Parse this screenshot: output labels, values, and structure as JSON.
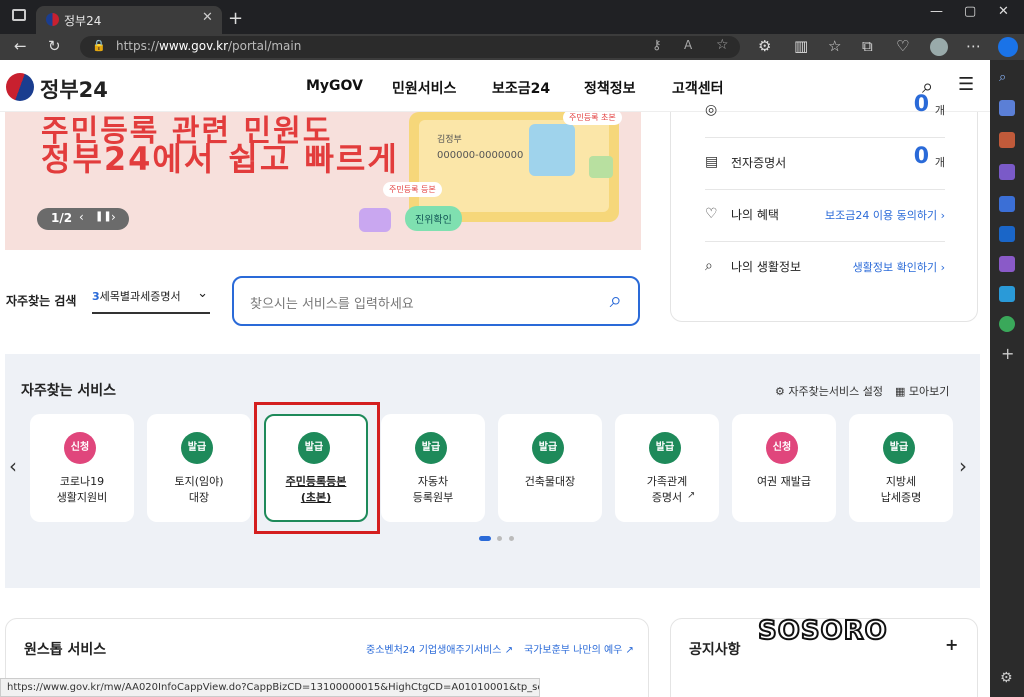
{
  "browser": {
    "tab_title": "정부24",
    "url_prefix": "https://",
    "url_host": "www.gov.kr",
    "url_path": "/portal/main",
    "status_url": "https://www.gov.kr/mw/AA020InfoCappView.do?CappBizCD=13100000015&HighCtgCD=A01010001&tp_seq=01&Mcode=10200"
  },
  "header": {
    "logo": "정부24",
    "nav": [
      "MyGOV",
      "민원서비스",
      "보조금24",
      "정책정보",
      "고객센터"
    ]
  },
  "banner": {
    "line1": "주민등록 관련 민원도",
    "line2": "정부24에서 쉽고 빠르게",
    "pager": "1/2",
    "card_name": "김정부",
    "card_number": "000000-0000000",
    "tag1": "주민등록 초본",
    "tag2": "주민등록 등본",
    "chip": "진위확인"
  },
  "right_panel": {
    "top_count": "0",
    "top_unit": "개",
    "items": [
      {
        "label": "전자증명서",
        "count": "0",
        "unit": "개"
      },
      {
        "label": "나의 혜택",
        "link": "보조금24 이용 동의하기"
      },
      {
        "label": "나의 생활정보",
        "link": "생활정보 확인하기"
      }
    ]
  },
  "search": {
    "label": "자주찾는 검색",
    "select_num": "3",
    "select_text": "세목별과세증명서",
    "placeholder": "찾으시는 서비스를 입력하세요"
  },
  "services": {
    "title": "자주찾는 서비스",
    "setting": "자주찾는서비스 설정",
    "view_all": "모아보기",
    "items": [
      {
        "badge": "신청",
        "color": "#e0467c",
        "name": "코로나19\n생활지원비"
      },
      {
        "badge": "발급",
        "color": "#1e8a5a",
        "name": "토지(임야)\n대장"
      },
      {
        "badge": "발급",
        "color": "#1e8a5a",
        "name": "주민등록등본\n(초본)"
      },
      {
        "badge": "발급",
        "color": "#1e8a5a",
        "name": "자동차\n등록원부"
      },
      {
        "badge": "발급",
        "color": "#1e8a5a",
        "name": "건축물대장"
      },
      {
        "badge": "발급",
        "color": "#1e8a5a",
        "name": "가족관계\n증명서"
      },
      {
        "badge": "신청",
        "color": "#e0467c",
        "name": "여권 재발급"
      },
      {
        "badge": "발급",
        "color": "#1e8a5a",
        "name": "지방세\n납세증명"
      }
    ]
  },
  "onestop": {
    "title": "원스톱 서비스",
    "link1": "중소벤처24 기업생애주기서비스",
    "link2": "국가보훈부 나만의 예우"
  },
  "notice": {
    "title": "공지사항",
    "more": "+"
  },
  "watermark": "SOSORO"
}
